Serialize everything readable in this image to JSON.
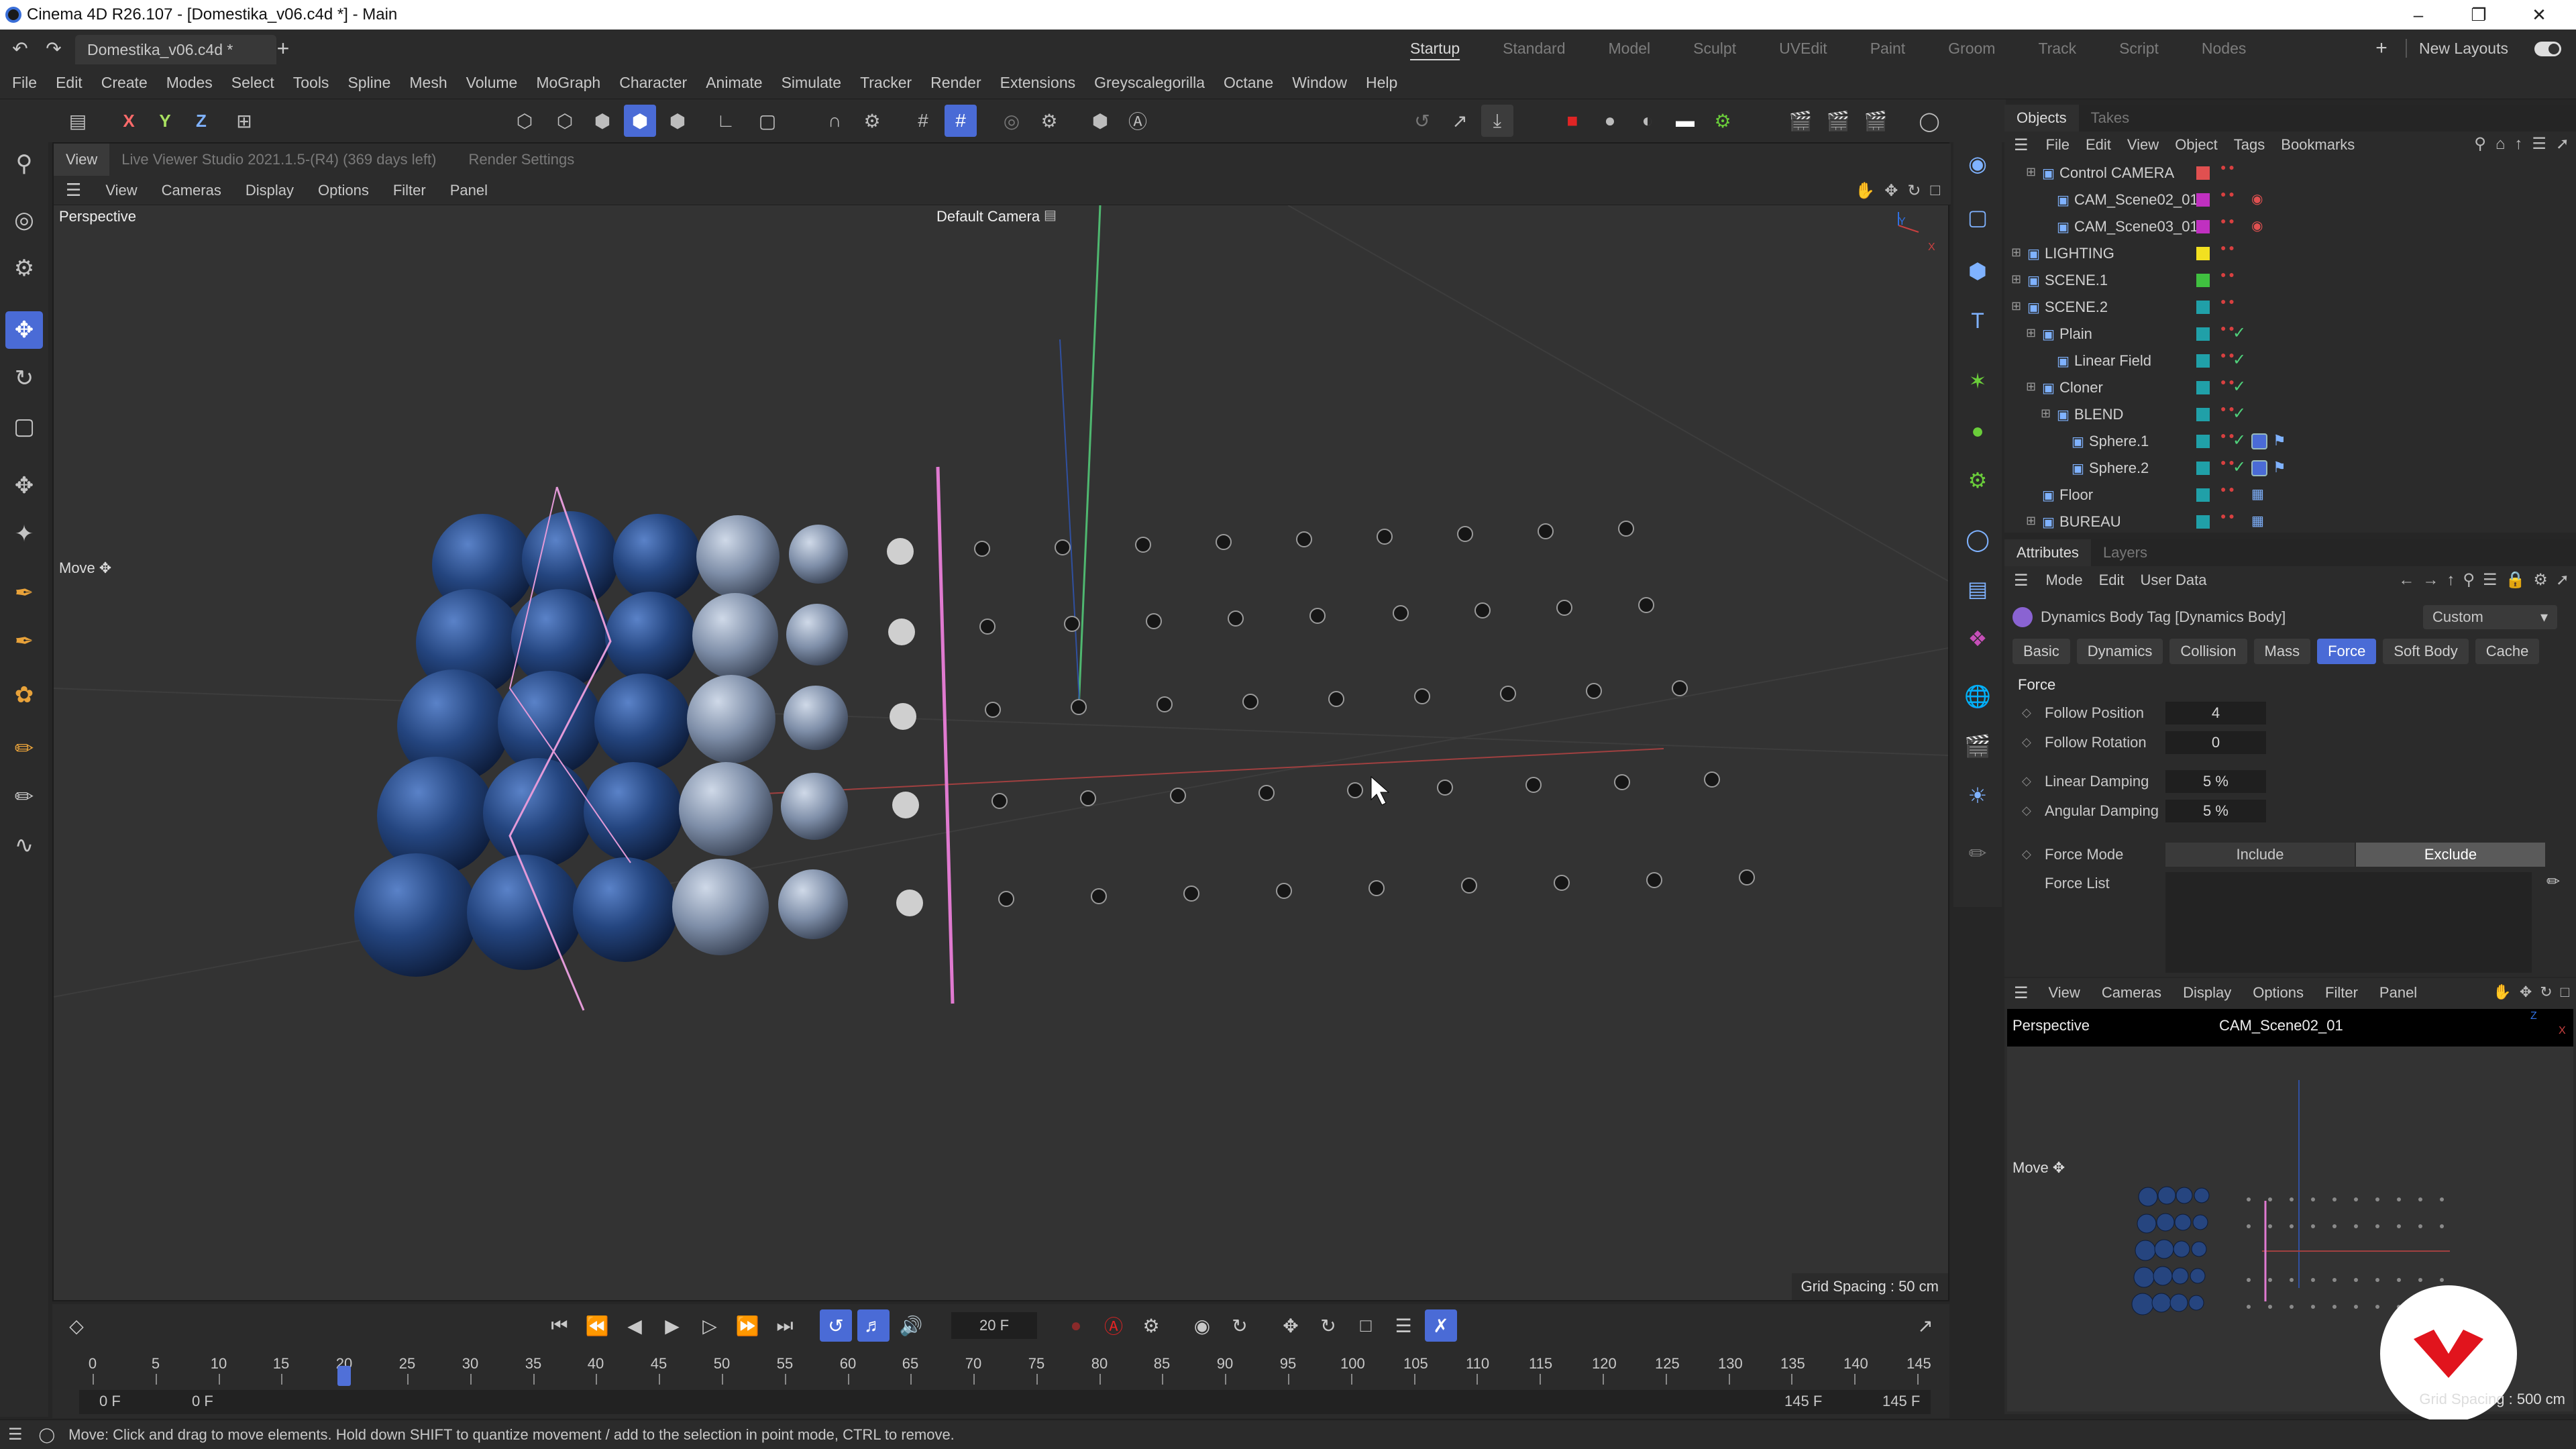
{
  "titlebar": {
    "app_title": "Cinema 4D R26.107 - [Domestika_v06.c4d *] - Main"
  },
  "tabs": {
    "document": "Domestika_v06.c4d *",
    "new_tab": "+"
  },
  "layouts": {
    "items": [
      "Startup",
      "Standard",
      "Model",
      "Sculpt",
      "UVEdit",
      "Paint",
      "Groom",
      "Track",
      "Script",
      "Nodes"
    ],
    "active": "Startup",
    "add": "+",
    "new_layouts": "New Layouts"
  },
  "menu": {
    "items": [
      "File",
      "Edit",
      "Create",
      "Modes",
      "Select",
      "Tools",
      "Spline",
      "Mesh",
      "Volume",
      "MoGraph",
      "Character",
      "Animate",
      "Simulate",
      "Tracker",
      "Render",
      "Extensions",
      "Greyscalegorilla",
      "Octane",
      "Window",
      "Help"
    ]
  },
  "axes": {
    "x": "X",
    "y": "Y",
    "z": "Z"
  },
  "viewport": {
    "row1": {
      "view": "View",
      "live_viewer": "Live Viewer Studio 2021.1.5-(R4) (369 days left)",
      "render_settings": "Render Settings"
    },
    "row2": [
      "View",
      "Cameras",
      "Display",
      "Options",
      "Filter",
      "Panel"
    ],
    "label": "Perspective",
    "camera": "Default Camera",
    "move_label": "Move",
    "grid_spacing": "Grid Spacing : 50 cm",
    "axis_y": "Y",
    "axis_x": "X"
  },
  "objects": {
    "tabs": [
      "Objects",
      "Takes"
    ],
    "menu": [
      "File",
      "Edit",
      "View",
      "Object",
      "Tags",
      "Bookmarks"
    ],
    "rows": [
      {
        "name": "Control CAMERA",
        "color": "#e05050"
      },
      {
        "name": "CAM_Scene02_01",
        "color": "#c030c0"
      },
      {
        "name": "CAM_Scene03_01",
        "color": "#c030c0"
      },
      {
        "name": "LIGHTING",
        "color": "#f2e020"
      },
      {
        "name": "SCENE.1",
        "color": "#40c040"
      },
      {
        "name": "SCENE.2",
        "color": "#20a0a8"
      },
      {
        "name": "Plain",
        "color": "#20a0a8"
      },
      {
        "name": "Linear Field",
        "color": "#20a0a8"
      },
      {
        "name": "Cloner",
        "color": "#20a0a8"
      },
      {
        "name": "BLEND",
        "color": "#20a0a8"
      },
      {
        "name": "Sphere.1",
        "color": "#20a0a8"
      },
      {
        "name": "Sphere.2",
        "color": "#20a0a8"
      },
      {
        "name": "Floor",
        "color": "#20a0a8"
      },
      {
        "name": "BUREAU",
        "color": "#20a0a8"
      }
    ]
  },
  "attributes": {
    "tabs": [
      "Attributes",
      "Layers"
    ],
    "menu": [
      "Mode",
      "Edit",
      "User Data"
    ],
    "title": "Dynamics Body Tag [Dynamics Body]",
    "preset": "Custom",
    "subtabs": [
      "Basic",
      "Dynamics",
      "Collision",
      "Mass",
      "Force",
      "Soft Body",
      "Cache"
    ],
    "active_subtab": "Force",
    "section": "Force",
    "fields": [
      {
        "label": "Follow Position",
        "value": "4"
      },
      {
        "label": "Follow Rotation",
        "value": "0"
      },
      {
        "label": "Linear Damping",
        "value": "5 %"
      },
      {
        "label": "Angular Damping",
        "value": "5 %"
      }
    ],
    "force_mode": {
      "label": "Force Mode",
      "options": [
        "Include",
        "Exclude"
      ],
      "selected": "Exclude"
    },
    "force_list": "Force List"
  },
  "mini_viewport": {
    "menu": [
      "View",
      "Cameras",
      "Display",
      "Options",
      "Filter",
      "Panel"
    ],
    "label": "Perspective",
    "camera": "CAM_Scene02_01",
    "move_label": "Move",
    "grid_spacing": "Grid Spacing : 500 cm",
    "axis_z": "Z",
    "axis_x": "X"
  },
  "timeline": {
    "current_frame": "20 F",
    "ticks": [
      "0",
      "5",
      "10",
      "15",
      "20",
      "25",
      "30",
      "35",
      "40",
      "45",
      "50",
      "55",
      "60",
      "65",
      "70",
      "75",
      "80",
      "85",
      "90",
      "95",
      "100",
      "105",
      "110",
      "115",
      "120",
      "125",
      "130",
      "135",
      "140",
      "145"
    ],
    "current": 20,
    "max": 145,
    "start": "0 F",
    "start2": "0 F",
    "end": "145 F",
    "end2": "145 F"
  },
  "status": {
    "text": "Move: Click and drag to move elements. Hold down SHIFT to quantize movement / add to the selection in point mode, CTRL to remove."
  }
}
